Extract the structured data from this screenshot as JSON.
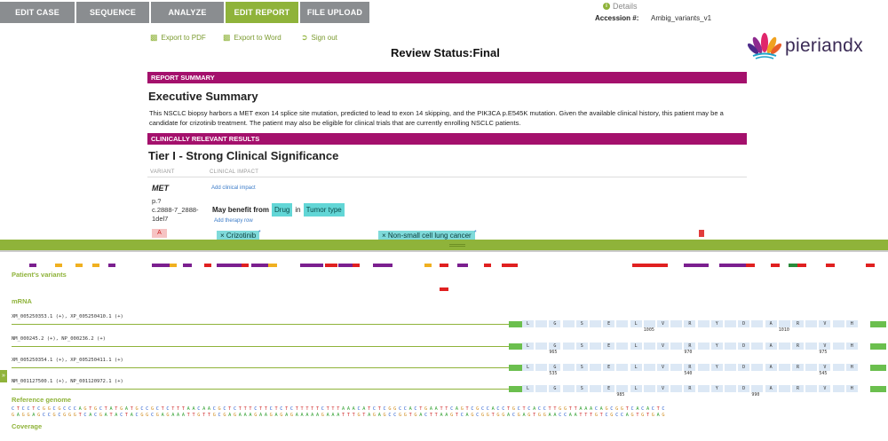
{
  "nav": {
    "tabs": [
      {
        "label": "EDIT CASE"
      },
      {
        "label": "SEQUENCE"
      },
      {
        "label": "ANALYZE"
      },
      {
        "label": "EDIT REPORT"
      },
      {
        "label": "FILE UPLOAD"
      }
    ],
    "details_label": "Details",
    "accession_label": "Accession #:",
    "accession_value": "Ambig_variants_v1"
  },
  "actions": {
    "export_pdf": "Export to PDF",
    "export_word": "Export to Word",
    "sign_out": "Sign out"
  },
  "review": {
    "label": "Review Status:",
    "value": "Final"
  },
  "logo": {
    "text": "pieriandx"
  },
  "report": {
    "summary_bar": "REPORT SUMMARY",
    "exec_heading": "Executive Summary",
    "exec_text": "This NSCLC biopsy harbors a MET exon 14 splice site mutation, predicted to lead to exon 14 skipping, and the PIK3CA p.E545K mutation. Given the available clinical history, this patient may be a candidate for crizotinib treatment. The patient may also be eligible for clinical trials that are currently enrolling NSCLC patients.",
    "results_bar": "CLINICALLY RELEVANT RESULTS",
    "tier_heading": "Tier I - Strong Clinical Significance",
    "col_variant": "VARIANT",
    "col_impact": "CLINICAL IMPACT",
    "gene": "MET",
    "protein_line1": "p.?",
    "protein_line2": "c.2888-7_2888-",
    "protein_line3": "1del7",
    "add_clinical_impact": "Add clinical impact",
    "benefit_text": "May benefit from",
    "drug_chip": "Drug",
    "in_text": "in",
    "tumor_chip": "Tumor type",
    "add_therapy_row": "Add therapy row",
    "tier_badge": "A",
    "drug_tag": "× Crizotinib",
    "tumor_tag": "× Non-small cell lung cancer",
    "star": "*"
  },
  "viewer": {
    "patients_variants": "Patient's variants",
    "mrna": "mRNA",
    "reference_genome": "Reference genome",
    "coverage": "Coverage",
    "transcripts": [
      {
        "label": "XM_005250353.1 (+), XP_005250410.1 (+)",
        "nums": [
          {
            "t": "1005",
            "i": 9
          },
          {
            "t": "1010",
            "i": 19
          }
        ]
      },
      {
        "label": "NM_000245.2 (+), NP_000236.2 (+)",
        "nums": [
          {
            "t": "965",
            "i": 2
          },
          {
            "t": "970",
            "i": 12
          },
          {
            "t": "975",
            "i": 22
          }
        ]
      },
      {
        "label": "XM_005250354.1 (+), XP_005250411.1 (+)",
        "nums": [
          {
            "t": "535",
            "i": 2
          },
          {
            "t": "540",
            "i": 12
          },
          {
            "t": "545",
            "i": 22
          }
        ]
      },
      {
        "label": "NM_001127500.1 (+), NP_001120972.1 (+)",
        "nums": [
          {
            "t": "985",
            "i": 7
          },
          {
            "t": "990",
            "i": 17
          }
        ]
      }
    ],
    "amino_acids": [
      "L",
      "",
      "G",
      "",
      "S",
      "",
      "E",
      "",
      "L",
      "",
      "V",
      "",
      "R",
      "",
      "Y",
      "",
      "D",
      "",
      "A",
      "",
      "R",
      "",
      "V",
      "",
      "H"
    ],
    "ref_seq_top": "CTCCTCGGCGCCCAGTGCTATGATGCCGCTCTTTAACAACGCTCTTTCTTCTCTCTTTTTCTTTAAACATCTCGGCCACTGAATTCAGTCGCCACCTGCTCACCTTGGTTAAACAGCGGTCACACTC",
    "ref_seq_bottom": "GAGGAGCCGCGGGTCACGATACTACGGCGAGAAATTGTTGCGAGAAAGAAGAGAGAAAAAGAAATTTGTAGAGCCGGTGACTTAAGTCAGCGGTGGACGAGTGGAACCAATTTGTCGCCAGTGTGAG"
  }
}
